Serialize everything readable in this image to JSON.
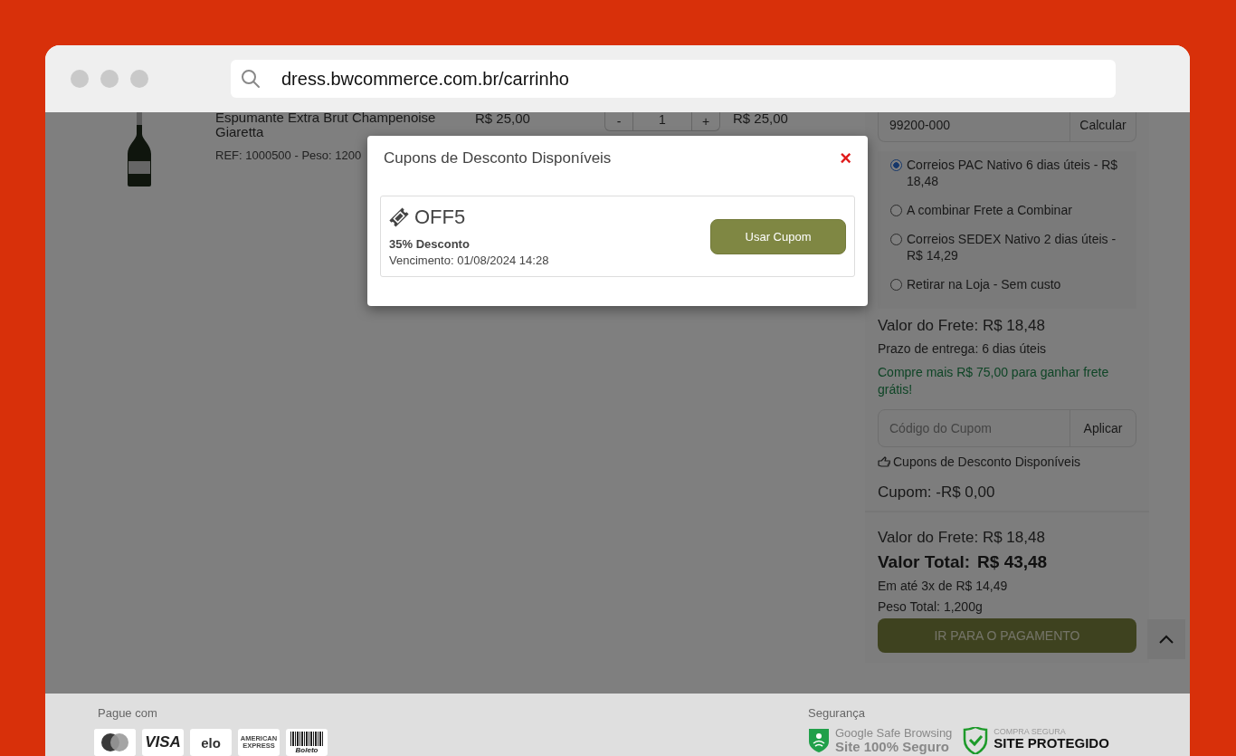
{
  "browser": {
    "url": "dress.bwcommerce.com.br/carrinho"
  },
  "cart": {
    "items": [
      {
        "name": "Espumante Extra Brut Champenoise Giaretta",
        "ref": "REF: 1000500 - Peso: 1200",
        "price": "R$ 25,00",
        "decrement": "-",
        "quantity": "1",
        "increment": "+",
        "total": "R$ 25,00"
      }
    ]
  },
  "shipping": {
    "cep": "99200-000",
    "calculate": "Calcular",
    "options": [
      {
        "label": "Correios PAC Nativo 6 dias úteis - R$ 18,48",
        "selected": true
      },
      {
        "label": "A combinar Frete a Combinar",
        "selected": false
      },
      {
        "label": "Correios SEDEX Nativo 2 dias úteis - R$ 14,29",
        "selected": false
      },
      {
        "label": "Retirar na Loja - Sem custo",
        "selected": false
      }
    ],
    "freight_value": "Valor do Frete: R$ 18,48",
    "delivery_time": "Prazo de entrega: 6 dias úteis",
    "free_shipping_note": "Compre mais R$ 75,00 para ganhar frete grátis!"
  },
  "coupon": {
    "placeholder": "Código do Cupom",
    "apply": "Aplicar",
    "available_link": "Cupons de Desconto Disponíveis",
    "discount": "Cupom: -R$ 0,00"
  },
  "totals": {
    "freight": "Valor do Frete: R$ 18,48",
    "total_label": "Valor Total:",
    "total_value": "R$ 43,48",
    "installments": "Em até 3x de R$ 14,49",
    "weight": "Peso Total: 1,200g"
  },
  "checkout_button": "IR PARA O PAGAMENTO",
  "modal": {
    "title": "Cupons de Desconto Disponíveis",
    "close": "×",
    "coupons": [
      {
        "code": "OFF5",
        "discount": "35% Desconto",
        "expiry": "Vencimento: 01/08/2024 14:28",
        "button": "Usar Cupom"
      }
    ]
  },
  "footer": {
    "payment_label": "Pague com",
    "payment_methods": [
      {
        "kind": "mastercard"
      },
      {
        "kind": "visa",
        "text": "VISA"
      },
      {
        "kind": "elo",
        "text": "elo"
      },
      {
        "kind": "amex",
        "text": "AMERICAN EXPRESS"
      },
      {
        "kind": "boleto",
        "text": "Boleto"
      }
    ],
    "security_label": "Segurança",
    "badges": [
      {
        "kind": "google",
        "title": "Google Safe Browsing",
        "subtitle": "Site 100% Seguro"
      },
      {
        "kind": "protected",
        "title": "COMPRA SEGURA",
        "subtitle": "SITE PROTEGIDO"
      }
    ]
  }
}
